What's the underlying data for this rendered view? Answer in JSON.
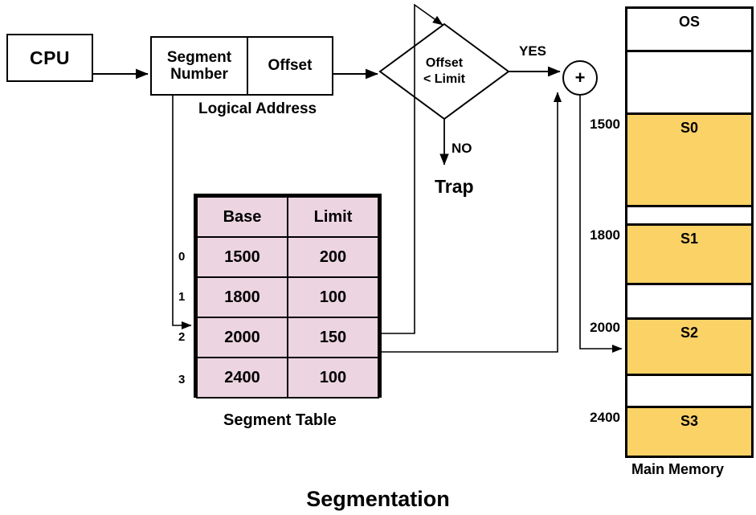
{
  "title": "Segmentation",
  "cpu": {
    "label": "CPU"
  },
  "logical_address": {
    "segment_label": "Segment\nNumber",
    "segment_line1": "Segment",
    "segment_line2": "Number",
    "offset_label": "Offset",
    "caption": "Logical  Address"
  },
  "decision": {
    "line1": "Offset",
    "line2": "< Limit",
    "yes_label": "YES",
    "no_label": "NO",
    "trap_label": "Trap"
  },
  "adder": {
    "symbol": "+"
  },
  "segment_table": {
    "caption": "Segment Table",
    "headers": [
      "Base",
      "Limit"
    ],
    "row_indices": [
      "0",
      "1",
      "2",
      "3"
    ],
    "rows": [
      {
        "index": "0",
        "base": "1500",
        "limit": "200"
      },
      {
        "index": "1",
        "base": "1800",
        "limit": "100"
      },
      {
        "index": "2",
        "base": "2000",
        "limit": "150"
      },
      {
        "index": "3",
        "base": "2400",
        "limit": "100"
      }
    ],
    "fill_color": "#ecd4e0"
  },
  "main_memory": {
    "caption": "Main Memory",
    "fill_color": "#fbd266",
    "cells": [
      {
        "label": "OS",
        "filled": false,
        "address": ""
      },
      {
        "label": "",
        "filled": false,
        "address": ""
      },
      {
        "label": "S0",
        "filled": true,
        "address": "1500"
      },
      {
        "label": "",
        "filled": false,
        "address": ""
      },
      {
        "label": "S1",
        "filled": true,
        "address": "1800"
      },
      {
        "label": "",
        "filled": false,
        "address": ""
      },
      {
        "label": "S2",
        "filled": true,
        "address": "2000"
      },
      {
        "label": "",
        "filled": false,
        "address": ""
      },
      {
        "label": "S3",
        "filled": true,
        "address": "2400"
      }
    ]
  }
}
